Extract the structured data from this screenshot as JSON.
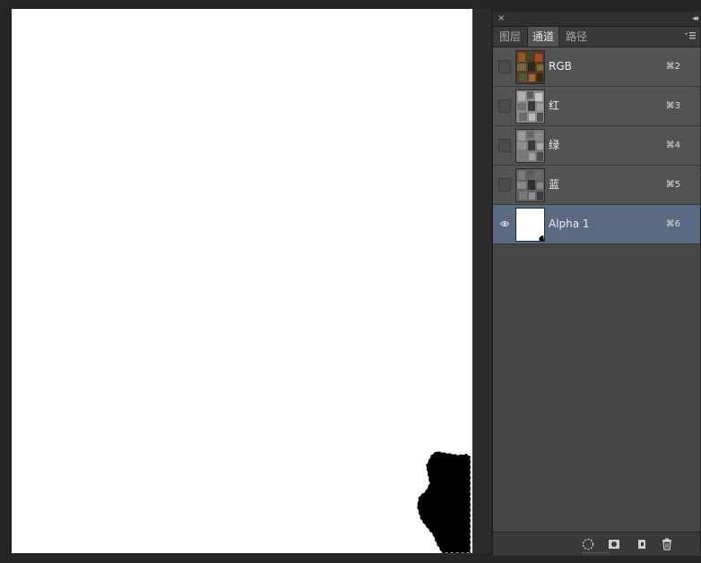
{
  "panel": {
    "close_glyph": "×",
    "collapse_glyph": "◂◂",
    "tabs": [
      {
        "label": "图层",
        "active": false
      },
      {
        "label": "通道",
        "active": true
      },
      {
        "label": "路径",
        "active": false
      }
    ],
    "menu_icon": "panel-menu-icon"
  },
  "channels": [
    {
      "name": "RGB",
      "shortcut": "⌘2",
      "visible": false,
      "selected": false,
      "thumb": "color"
    },
    {
      "name": "红",
      "shortcut": "⌘3",
      "visible": false,
      "selected": false,
      "thumb": "gray"
    },
    {
      "name": "绿",
      "shortcut": "⌘4",
      "visible": false,
      "selected": false,
      "thumb": "gray"
    },
    {
      "name": "蓝",
      "shortcut": "⌘5",
      "visible": false,
      "selected": false,
      "thumb": "gray"
    },
    {
      "name": "Alpha 1",
      "shortcut": "⌘6",
      "visible": true,
      "selected": true,
      "thumb": "alpha"
    }
  ],
  "footer_buttons": [
    {
      "icon": "load-selection-icon"
    },
    {
      "icon": "save-selection-mask-icon"
    },
    {
      "icon": "new-channel-icon"
    },
    {
      "icon": "trash-icon"
    }
  ],
  "colors": {
    "canvas": "#ffffff",
    "mask": "#000000",
    "panel_bg": "#474747",
    "row_bg": "#535353",
    "row_selected": "#596a82"
  }
}
